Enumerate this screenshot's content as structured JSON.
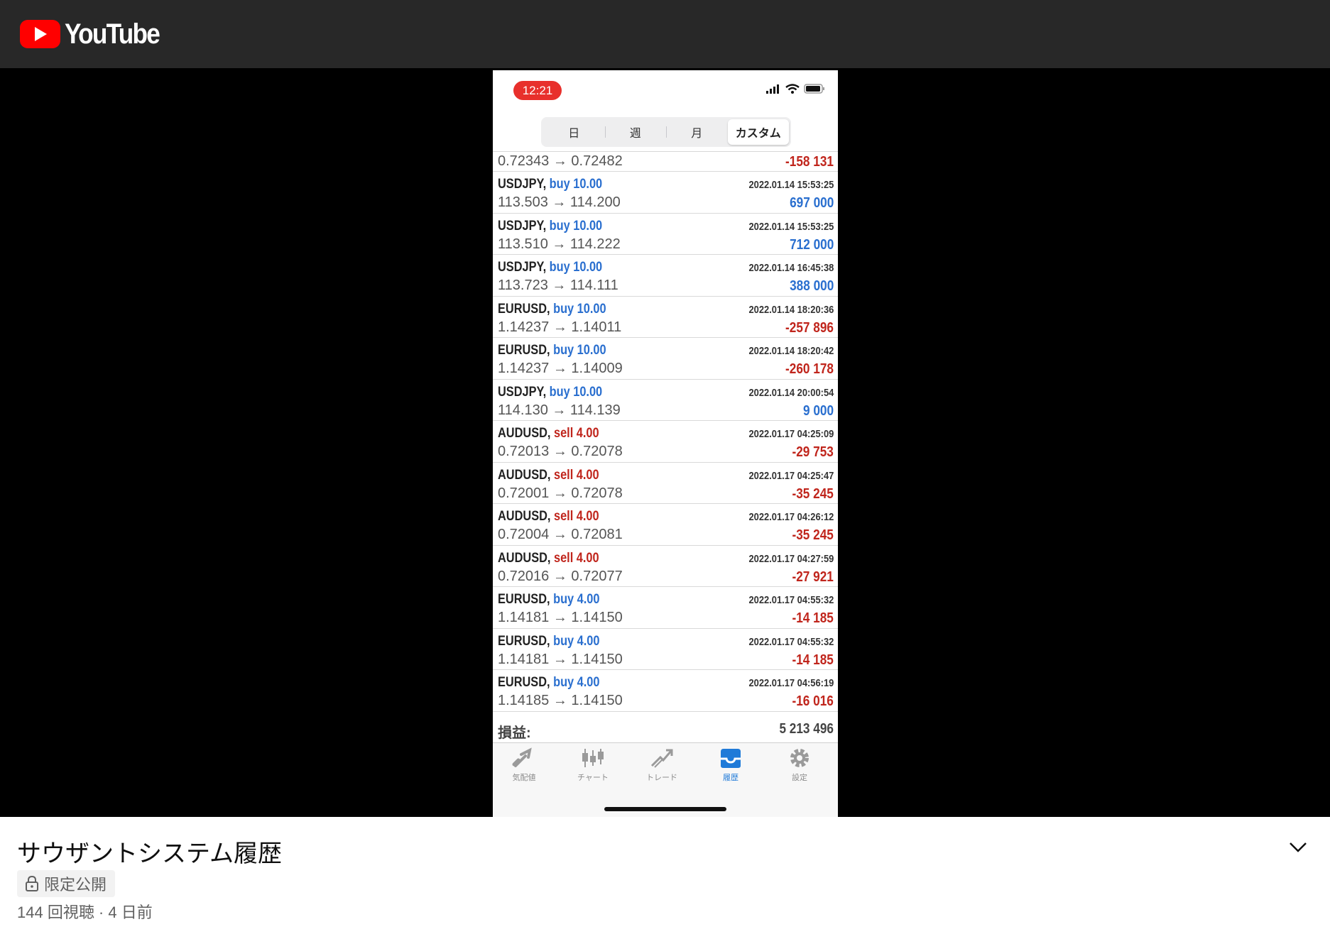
{
  "header": {
    "logo_text": "YouTube",
    "logo_icon": "youtube-play-icon"
  },
  "phone": {
    "time": "12:21",
    "segments": [
      "日",
      "週",
      "月",
      "カスタム"
    ],
    "active_segment": 3,
    "partial_row": {
      "prices": "0.72343 → 0.72482",
      "profit": "-158 131"
    },
    "trades": [
      {
        "symbol": "USDJPY,",
        "side": "buy 10.00",
        "date": "2022.01.14 15:53:25",
        "prices": "113.503 → 114.200",
        "profit": "697 000",
        "dir": "buy",
        "sign": "pos"
      },
      {
        "symbol": "USDJPY,",
        "side": "buy 10.00",
        "date": "2022.01.14 15:53:25",
        "prices": "113.510 → 114.222",
        "profit": "712 000",
        "dir": "buy",
        "sign": "pos"
      },
      {
        "symbol": "USDJPY,",
        "side": "buy 10.00",
        "date": "2022.01.14 16:45:38",
        "prices": "113.723 → 114.111",
        "profit": "388 000",
        "dir": "buy",
        "sign": "pos"
      },
      {
        "symbol": "EURUSD,",
        "side": "buy 10.00",
        "date": "2022.01.14 18:20:36",
        "prices": "1.14237 → 1.14011",
        "profit": "-257 896",
        "dir": "buy",
        "sign": "neg"
      },
      {
        "symbol": "EURUSD,",
        "side": "buy 10.00",
        "date": "2022.01.14 18:20:42",
        "prices": "1.14237 → 1.14009",
        "profit": "-260 178",
        "dir": "buy",
        "sign": "neg"
      },
      {
        "symbol": "USDJPY,",
        "side": "buy 10.00",
        "date": "2022.01.14 20:00:54",
        "prices": "114.130 → 114.139",
        "profit": "9 000",
        "dir": "buy",
        "sign": "pos"
      },
      {
        "symbol": "AUDUSD,",
        "side": "sell 4.00",
        "date": "2022.01.17 04:25:09",
        "prices": "0.72013 → 0.72078",
        "profit": "-29 753",
        "dir": "sell",
        "sign": "neg"
      },
      {
        "symbol": "AUDUSD,",
        "side": "sell 4.00",
        "date": "2022.01.17 04:25:47",
        "prices": "0.72001 → 0.72078",
        "profit": "-35 245",
        "dir": "sell",
        "sign": "neg"
      },
      {
        "symbol": "AUDUSD,",
        "side": "sell 4.00",
        "date": "2022.01.17 04:26:12",
        "prices": "0.72004 → 0.72081",
        "profit": "-35 245",
        "dir": "sell",
        "sign": "neg"
      },
      {
        "symbol": "AUDUSD,",
        "side": "sell 4.00",
        "date": "2022.01.17 04:27:59",
        "prices": "0.72016 → 0.72077",
        "profit": "-27 921",
        "dir": "sell",
        "sign": "neg"
      },
      {
        "symbol": "EURUSD,",
        "side": "buy 4.00",
        "date": "2022.01.17 04:55:32",
        "prices": "1.14181 → 1.14150",
        "profit": "-14 185",
        "dir": "buy",
        "sign": "neg"
      },
      {
        "symbol": "EURUSD,",
        "side": "buy 4.00",
        "date": "2022.01.17 04:55:32",
        "prices": "1.14181 → 1.14150",
        "profit": "-14 185",
        "dir": "buy",
        "sign": "neg"
      },
      {
        "symbol": "EURUSD,",
        "side": "buy 4.00",
        "date": "2022.01.17 04:56:19",
        "prices": "1.14185 → 1.14150",
        "profit": "-16 016",
        "dir": "buy",
        "sign": "neg"
      }
    ],
    "total_label": "損益:",
    "total_value": "5 213 496",
    "tabs": [
      {
        "label": "気配値",
        "icon": "quotes-icon"
      },
      {
        "label": "チャート",
        "icon": "chart-candles-icon"
      },
      {
        "label": "トレード",
        "icon": "trade-icon"
      },
      {
        "label": "履歴",
        "icon": "history-icon"
      },
      {
        "label": "設定",
        "icon": "gear-icon"
      }
    ],
    "active_tab": 3
  },
  "video": {
    "title": "サウザントシステム履歴",
    "visibility": "限定公開",
    "meta": "144 回視聴 · 4 日前"
  },
  "colors": {
    "buy": "#2a6fcf",
    "sell": "#c0251c",
    "time_pill": "#e8302c",
    "header_bg": "#282828",
    "active_tab": "#1f7ad8"
  }
}
